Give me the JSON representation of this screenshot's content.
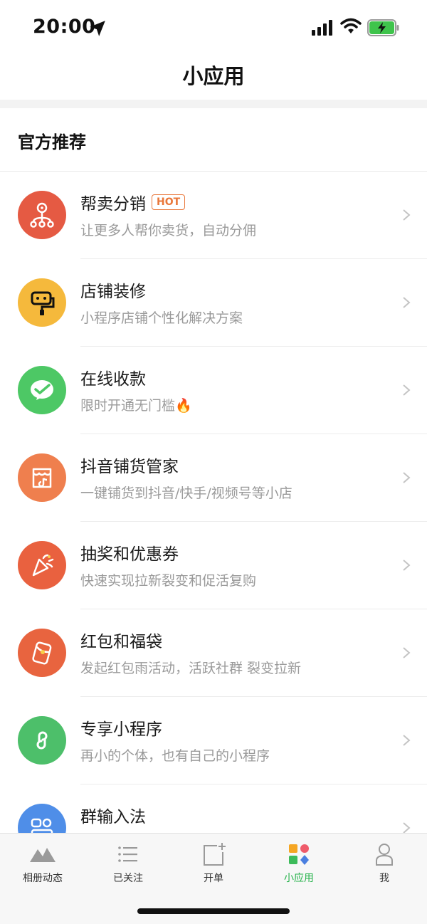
{
  "status_bar": {
    "time": "20:00"
  },
  "header": {
    "title": "小应用"
  },
  "section": {
    "title": "官方推荐"
  },
  "items": [
    {
      "title": "帮卖分销",
      "badge": "HOT",
      "subtitle": "让更多人帮你卖货，自动分佣",
      "icon": "distribution-icon",
      "color": "#e55a43"
    },
    {
      "title": "店铺装修",
      "subtitle": "小程序店铺个性化解决方案",
      "icon": "paint-roller-icon",
      "color": "#f5b93c"
    },
    {
      "title": "在线收款",
      "subtitle": "限时开通无门槛🔥",
      "icon": "wechat-pay-icon",
      "color": "#4dc865"
    },
    {
      "title": "抖音铺货管家",
      "subtitle": "一键铺货到抖音/快手/视频号等小店",
      "icon": "store-icon",
      "color": "#ef7f4e"
    },
    {
      "title": "抽奖和优惠券",
      "subtitle": "快速实现拉新裂变和促活复购",
      "icon": "party-popper-icon",
      "color": "#e9613f"
    },
    {
      "title": "红包和福袋",
      "subtitle": "发起红包雨活动，活跃社群 裂变拉新",
      "icon": "red-packet-icon",
      "color": "#e8643f"
    },
    {
      "title": "专享小程序",
      "subtitle": "再小的个体，也有自己的小程序",
      "icon": "mini-program-icon",
      "color": "#4dbf6a"
    },
    {
      "title": "群输入法",
      "subtitle": "",
      "icon": "keyboard-icon",
      "color": "#4f8ee8"
    }
  ],
  "tabbar": {
    "tabs": [
      {
        "label": "相册动态",
        "icon": "mountain-icon"
      },
      {
        "label": "已关注",
        "icon": "list-icon"
      },
      {
        "label": "开单",
        "icon": "new-order-icon"
      },
      {
        "label": "小应用",
        "icon": "apps-icon",
        "active": true
      },
      {
        "label": "我",
        "icon": "profile-icon"
      }
    ],
    "active_color": "#24b24a"
  }
}
